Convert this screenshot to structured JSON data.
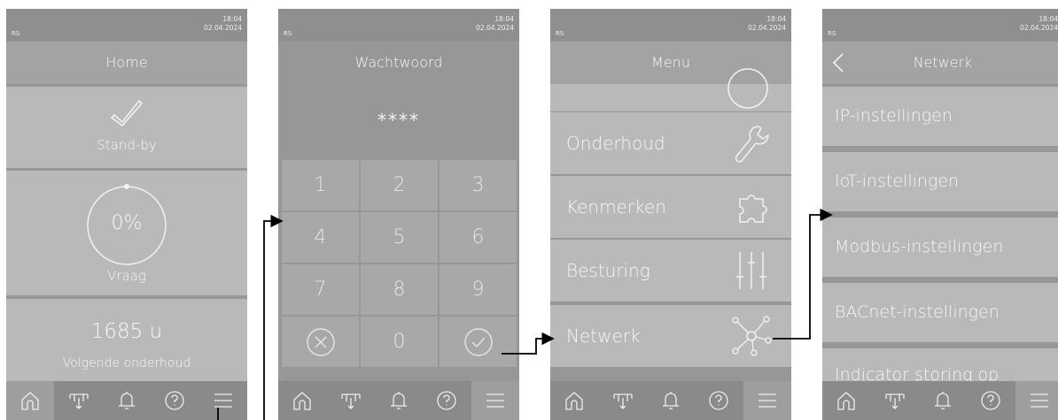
{
  "status": {
    "left": "RS",
    "time": "18:04",
    "date": "02.04.2024"
  },
  "home": {
    "title": "Home",
    "standby_label": "Stand-by",
    "demand_value": "0%",
    "demand_label": "Vraag",
    "maintenance_value": "1685 u",
    "maintenance_label": "Volgende onderhoud"
  },
  "password": {
    "title": "Wachtwoord",
    "masked": "****",
    "keys": [
      "1",
      "2",
      "3",
      "4",
      "5",
      "6",
      "7",
      "8",
      "9",
      "0"
    ]
  },
  "menu": {
    "title": "Menu",
    "items": [
      "Onderhoud",
      "Kenmerken",
      "Besturing",
      "Netwerk"
    ]
  },
  "network": {
    "title": "Netwerk",
    "items": [
      "IP-instellingen",
      "IoT-instellingen",
      "Modbus-instellingen",
      "BACnet-instellingen",
      "Indicator storing op"
    ]
  },
  "nav_icons": [
    "home-icon",
    "humidifier-icon",
    "bell-icon",
    "help-icon",
    "menu-icon"
  ],
  "colors": {
    "screen": "#979797",
    "tile": "#b9b9b9",
    "arrow": "#000000"
  }
}
